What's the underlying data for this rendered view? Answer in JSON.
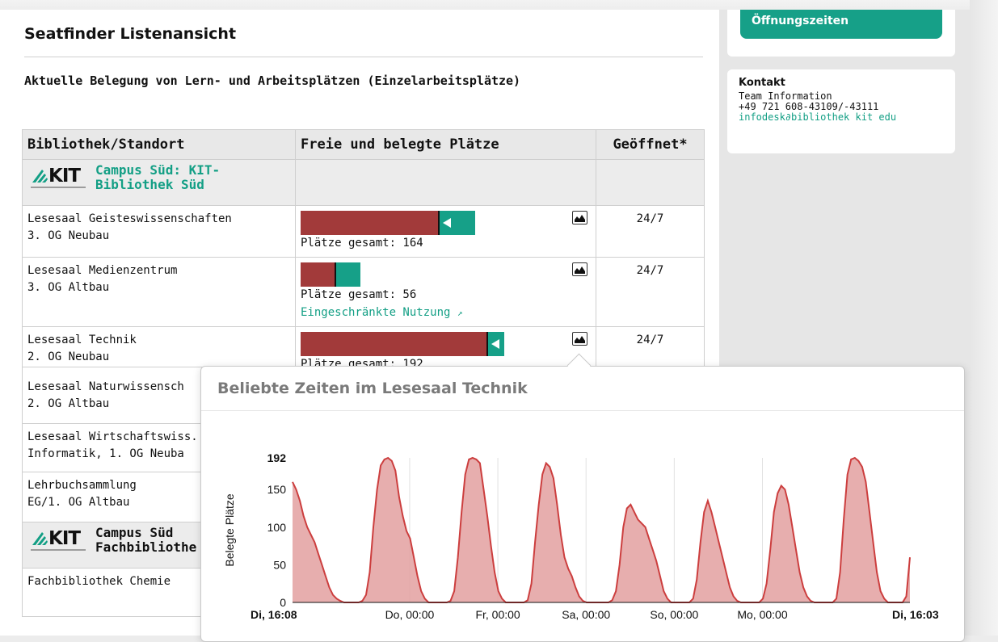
{
  "page": {
    "title": "Seatfinder Listenansicht",
    "subtitle": "Aktuelle Belegung von Lern- und Arbeitsplätzen (Einzelarbeitsplätze)"
  },
  "table": {
    "headers": [
      "Bibliothek/Standort",
      "Freie und belegte Plätze",
      "Geöffnet*"
    ],
    "campus1": {
      "name_line1": "Campus Süd: KIT-",
      "name_line2": "Bibliothek Süd",
      "logo_text": "KIT"
    },
    "rows": [
      {
        "name": "Lesesaal Geisteswissenschaften",
        "location": "3. OG Neubau",
        "total_label": "Plätze gesamt: 164",
        "open": "24/7",
        "occupied_fraction": 0.79
      },
      {
        "name": "Lesesaal Medienzentrum",
        "location": "3. OG Altbau",
        "total_label": "Plätze gesamt: 56",
        "open": "24/7",
        "occupied_fraction": 0.56,
        "note": "Eingeschränkte Nutzung"
      },
      {
        "name": "Lesesaal Technik",
        "location": "2. OG Neubau",
        "total_label": "Plätze gesamt: 192",
        "open": "24/7",
        "occupied_fraction": 0.91
      },
      {
        "name": "Lesesaal Naturwissensch",
        "location": "2. OG Altbau"
      },
      {
        "name": "Lesesaal Wirtschaftswiss.",
        "location": "Informatik, 1. OG Neuba"
      },
      {
        "name": "Lehrbuchsammlung",
        "location": "EG/1. OG Altbau"
      }
    ],
    "campus2": {
      "name_line1": "Campus Süd",
      "name_line2": "Fachbibliothe",
      "logo_text": "KIT"
    },
    "rows2": [
      {
        "name": "Fachbibliothek Chemie"
      }
    ]
  },
  "sidebar": {
    "button_label": "Öffnungszeiten",
    "contact": {
      "heading": "Kontakt",
      "team": "Team Information",
      "phone": "+49 721 608-43109/-43111",
      "email": "infodesk∂bibliothek kit edu"
    }
  },
  "popover": {
    "title": "Beliebte Zeiten im Lesesaal Technik"
  },
  "chart_data": {
    "type": "area",
    "title": "Beliebte Zeiten im Lesesaal Technik",
    "ylabel": "Belegte Plätze",
    "ylim": [
      0,
      192
    ],
    "yticks": [
      0,
      50,
      100,
      150,
      192
    ],
    "xtick_labels": [
      "Di, 16:08",
      "Do, 00:00",
      "Fr, 00:00",
      "Sa, 00:00",
      "So, 00:00",
      "Mo, 00:00",
      "Di, 16:03"
    ],
    "xtick_hours": [
      0,
      31.87,
      55.87,
      79.87,
      103.87,
      127.87,
      167.92
    ],
    "x_hours": [
      0,
      1,
      2,
      3,
      4,
      5,
      6,
      7,
      8,
      9,
      10,
      11,
      12,
      13,
      14,
      15,
      16,
      17,
      18,
      19,
      20,
      21,
      22,
      23,
      24,
      25,
      26,
      27,
      28,
      29,
      30,
      31,
      32,
      33,
      34,
      35,
      36,
      37,
      38,
      39,
      40,
      41,
      42,
      43,
      44,
      45,
      46,
      47,
      48,
      49,
      50,
      51,
      52,
      53,
      54,
      55,
      56,
      57,
      58,
      59,
      60,
      61,
      62,
      63,
      64,
      65,
      66,
      67,
      68,
      69,
      70,
      71,
      72,
      73,
      74,
      75,
      76,
      77,
      78,
      79,
      80,
      81,
      82,
      83,
      84,
      85,
      86,
      87,
      88,
      89,
      90,
      91,
      92,
      93,
      94,
      95,
      96,
      97,
      98,
      99,
      100,
      101,
      102,
      103,
      104,
      105,
      106,
      107,
      108,
      109,
      110,
      111,
      112,
      113,
      114,
      115,
      116,
      117,
      118,
      119,
      120,
      121,
      122,
      123,
      124,
      125,
      126,
      127,
      128,
      129,
      130,
      131,
      132,
      133,
      134,
      135,
      136,
      137,
      138,
      139,
      140,
      141,
      142,
      143,
      144,
      145,
      146,
      147,
      148,
      149,
      150,
      151,
      152,
      153,
      154,
      155,
      156,
      157,
      158,
      159,
      160,
      161,
      162,
      163,
      164,
      165,
      166,
      167,
      168
    ],
    "values": [
      160,
      150,
      135,
      115,
      100,
      90,
      80,
      65,
      50,
      35,
      20,
      10,
      5,
      2,
      0,
      0,
      0,
      0,
      0,
      2,
      10,
      40,
      100,
      150,
      182,
      190,
      192,
      188,
      175,
      140,
      115,
      95,
      85,
      60,
      35,
      15,
      5,
      0,
      0,
      0,
      0,
      0,
      0,
      2,
      15,
      60,
      120,
      170,
      190,
      192,
      190,
      185,
      150,
      115,
      75,
      40,
      15,
      5,
      0,
      0,
      0,
      0,
      0,
      0,
      3,
      25,
      80,
      130,
      170,
      185,
      180,
      165,
      130,
      90,
      60,
      45,
      35,
      20,
      8,
      2,
      0,
      0,
      0,
      0,
      0,
      0,
      0,
      3,
      15,
      50,
      100,
      125,
      130,
      120,
      110,
      105,
      100,
      85,
      70,
      55,
      35,
      15,
      5,
      0,
      0,
      0,
      0,
      0,
      0,
      5,
      30,
      80,
      120,
      135,
      120,
      100,
      80,
      60,
      40,
      20,
      8,
      2,
      0,
      0,
      0,
      0,
      0,
      0,
      5,
      25,
      70,
      120,
      145,
      155,
      150,
      130,
      100,
      70,
      40,
      20,
      8,
      2,
      0,
      0,
      0,
      0,
      0,
      0,
      5,
      40,
      110,
      170,
      190,
      192,
      188,
      180,
      160,
      120,
      80,
      40,
      15,
      5,
      0,
      0,
      0,
      0,
      0,
      8,
      60,
      150,
      190,
      180,
      175
    ]
  },
  "colors": {
    "accent": "#16a088",
    "occupied": "#a23a3a",
    "chart_line": "#cc3e3e",
    "chart_fill": "#e3a0a0"
  }
}
